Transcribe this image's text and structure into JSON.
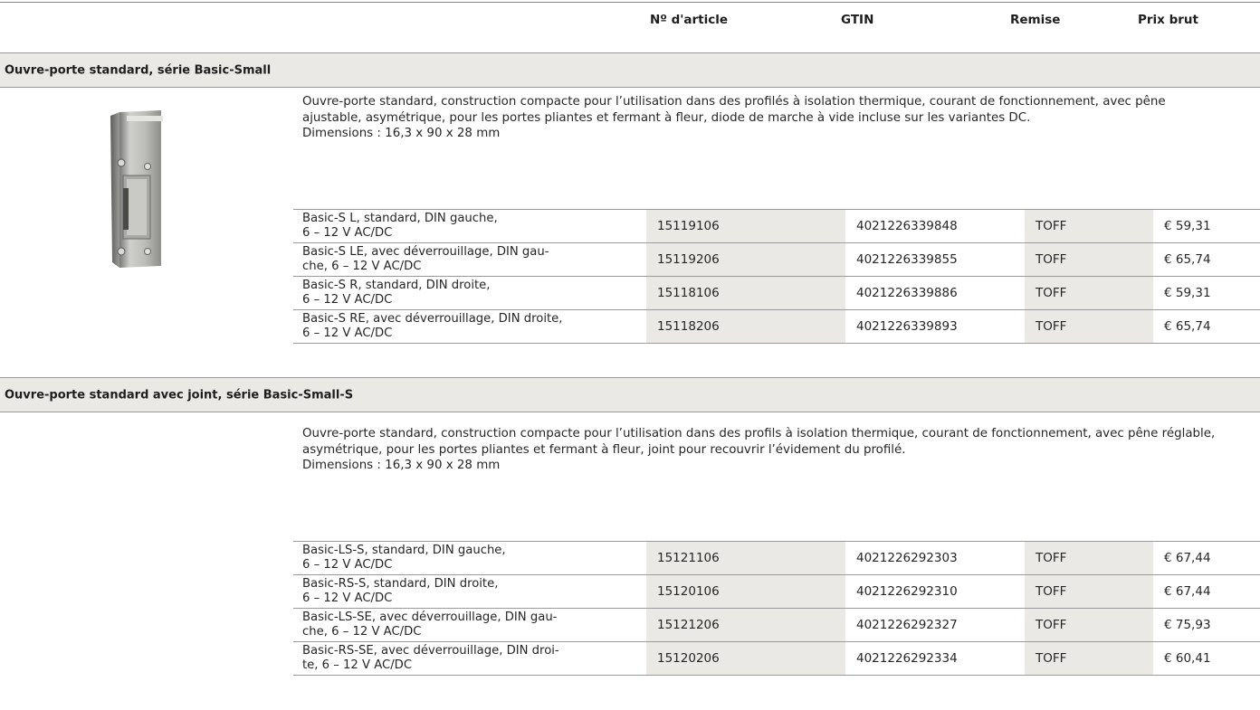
{
  "columns": {
    "article": "Nº d'article",
    "gtin": "GTIN",
    "remise": "Remise",
    "prix": "Prix brut"
  },
  "sections": [
    {
      "title": "Ouvre-porte standard, série Basic-Small",
      "description": "Ouvre-porte standard, construction compacte pour l’utilisation dans des profilés à isolation thermique, courant de foncti­onnement, avec pêne ajustable, asymétrique, pour les portes pliantes et fermant à fleur, diode de marche à vide incluse sur les variantes DC.",
      "dimensions": "Dimensions : 16,3 x 90 x 28 mm",
      "rows": [
        {
          "name_1": "Basic-S L, standard, DIN gauche,",
          "name_2": "6 – 12 V AC/DC",
          "article": "15119106",
          "gtin": "4021226339848",
          "remise": "TOFF",
          "prix": "€ 59,31"
        },
        {
          "name_1": "Basic-S LE, avec déverrouillage, DIN gau-",
          "name_2": "che, 6 – 12 V AC/DC",
          "article": "15119206",
          "gtin": "4021226339855",
          "remise": "TOFF",
          "prix": "€ 65,74"
        },
        {
          "name_1": "Basic-S R, standard, DIN droite,",
          "name_2": "6 – 12 V AC/DC",
          "article": "15118106",
          "gtin": "4021226339886",
          "remise": "TOFF",
          "prix": "€ 59,31"
        },
        {
          "name_1": "Basic-S RE, avec déverrouillage, DIN droite,",
          "name_2": "6 – 12 V AC/DC",
          "article": "15118206",
          "gtin": "4021226339893",
          "remise": "TOFF",
          "prix": "€ 65,74"
        }
      ]
    },
    {
      "title": "Ouvre-porte standard avec joint, série Basic-Small-S",
      "description": "Ouvre-porte standard, construction compacte pour l’utilisation dans des profils à isolation thermique, courant de fonctionne­ment, avec pêne réglable, asymétrique, pour les portes pliantes et fermant à fleur, joint pour recouvrir l’évidement du profilé.",
      "dimensions": "Dimensions : 16,3 x 90 x 28 mm",
      "rows": [
        {
          "name_1": "Basic-LS-S, standard, DIN gauche,",
          "name_2": "6 – 12 V AC/DC",
          "article": "15121106",
          "gtin": "4021226292303",
          "remise": "TOFF",
          "prix": "€ 67,44"
        },
        {
          "name_1": "Basic-RS-S, standard, DIN droite,",
          "name_2": "6 – 12 V AC/DC",
          "article": "15120106",
          "gtin": "4021226292310",
          "remise": "TOFF",
          "prix": "€ 67,44"
        },
        {
          "name_1": "Basic-LS-SE, avec déverrouillage, DIN gau-",
          "name_2": "che, 6 – 12 V AC/DC",
          "article": "15121206",
          "gtin": "4021226292327",
          "remise": "TOFF",
          "prix": "€ 75,93"
        },
        {
          "name_1": "Basic-RS-SE, avec déverrouillage, DIN droi-",
          "name_2": "te, 6 – 12 V AC/DC",
          "article": "15120206",
          "gtin": "4021226292334",
          "remise": "TOFF",
          "prix": "€ 60,41"
        }
      ]
    }
  ],
  "icons": {
    "product_image": "door-opener-image"
  }
}
